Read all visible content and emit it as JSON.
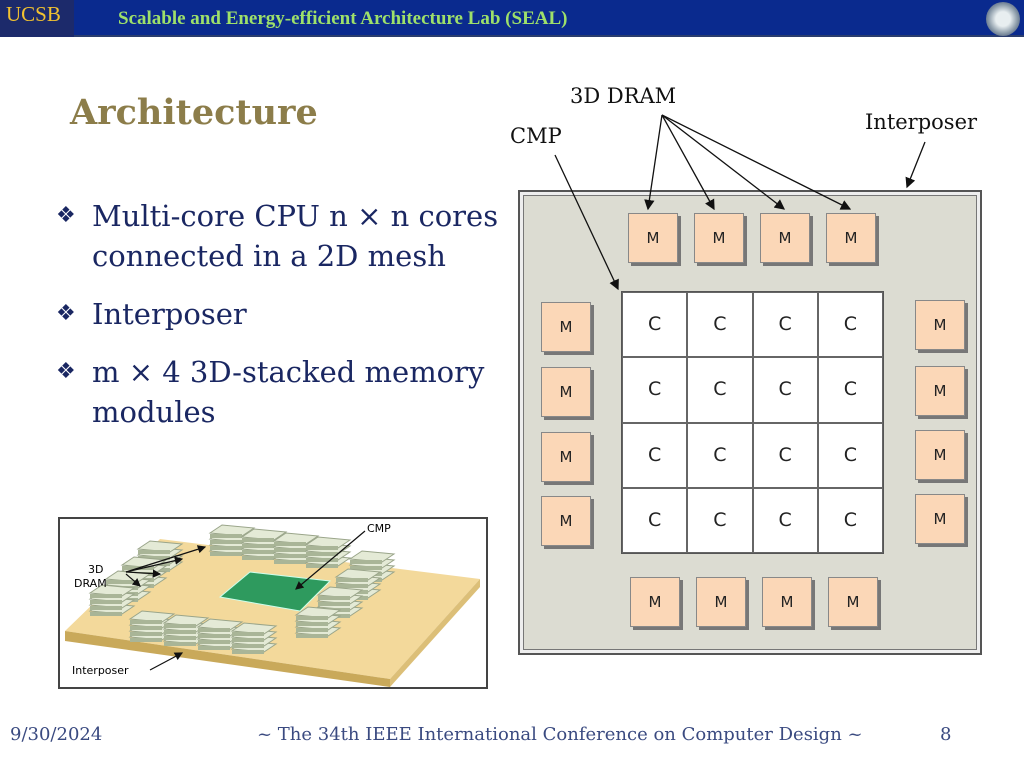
{
  "header": {
    "logo": "UCSB",
    "title": "Scalable and Energy-efficient Architecture Lab (SEAL)"
  },
  "slide": {
    "title": "Architecture",
    "bullets": [
      {
        "marker": "❖",
        "text": "Multi-core CPU n × n cores connected in a 2D mesh"
      },
      {
        "marker": "❖",
        "text": "Interposer"
      },
      {
        "marker": "❖",
        "text": "m × 4 3D-stacked memory modules"
      }
    ]
  },
  "diagram": {
    "labels": {
      "dram": "3D DRAM",
      "cmp": "CMP",
      "interposer": "Interposer"
    },
    "mem": "M",
    "core": "C",
    "colors": {
      "mem": "#fbd7b7",
      "board": "#dcdcd2"
    }
  },
  "figure": {
    "cmp": "CMP",
    "dram_line1": "3D",
    "dram_line2": "DRAM",
    "interposer": "Interposer"
  },
  "footer": {
    "date": "9/30/2024",
    "conference": "~ The 34th IEEE International Conference on Computer Design ~",
    "page": "8"
  }
}
